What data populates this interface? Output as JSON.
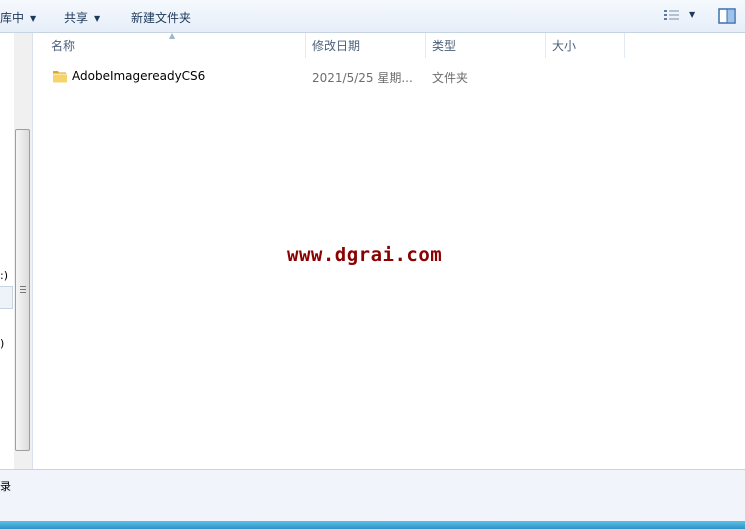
{
  "toolbar": {
    "library_label": "库中",
    "share_label": "共享",
    "new_folder_label": "新建文件夹",
    "views_icon": "details-view-icon",
    "preview_icon": "preview-pane-icon"
  },
  "navpane": {
    "frag1": ":)",
    "frag2": ")"
  },
  "columns": {
    "name": "名称",
    "date": "修改日期",
    "type": "类型",
    "size": "大小"
  },
  "files": [
    {
      "name": "AdobeImagereadyCS6",
      "date": "2021/5/25 星期...",
      "type": "文件夹",
      "size": "",
      "icon": "folder-icon"
    }
  ],
  "watermark": "www.dgrai.com",
  "details": {
    "frag": "录"
  },
  "colors": {
    "toolbar_bg": "#e6eef8",
    "watermark": "#8b0000",
    "bottom_bar": "#2d93c8"
  }
}
